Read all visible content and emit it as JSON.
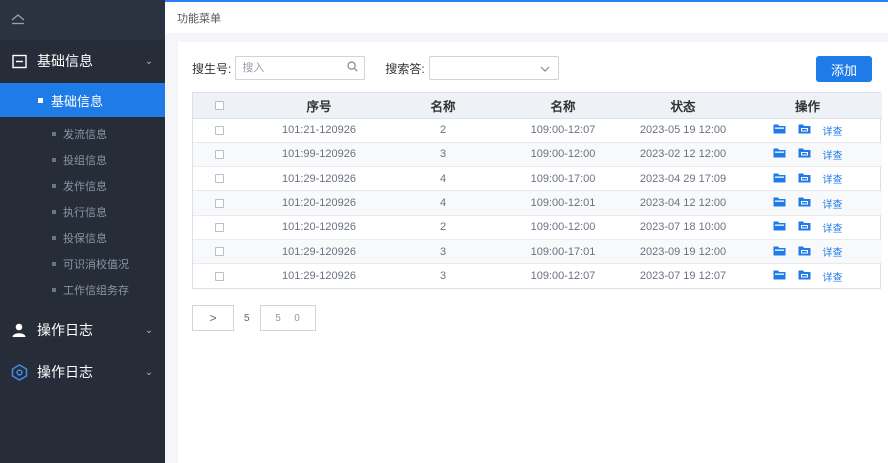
{
  "sidebar": {
    "groups": [
      {
        "label": "基础信息",
        "icon": "info-box-icon"
      },
      {
        "label": "操作日志",
        "icon": "user-icon"
      },
      {
        "label": "操作日志",
        "icon": "hexagon-settings-icon"
      }
    ],
    "active_item": "基础信息",
    "sub_items": [
      "发流信息",
      "投组信息",
      "发作信息",
      "执行信息",
      "投保信息",
      "可识消校值况",
      "工作信组务存"
    ]
  },
  "topbar": {
    "title": "功能菜单"
  },
  "filters": {
    "search_label": "搜生号:",
    "search_placeholder": "搜入",
    "select_label": "搜索答:",
    "select_value": ""
  },
  "add_button": "添加",
  "table": {
    "headers": [
      "",
      "序号",
      "名称",
      "名称",
      "状态",
      "操作"
    ],
    "rows": [
      {
        "id": "101:21-120926",
        "count": "2",
        "time": "109:00-12:07",
        "date": "2023-05 19 12:00",
        "link": "详查"
      },
      {
        "id": "101:99-120926",
        "count": "3",
        "time": "109:00-12:00",
        "date": "2023-02 12 12:00",
        "link": "详查"
      },
      {
        "id": "101:29-120926",
        "count": "4",
        "time": "109:00-17:00",
        "date": "2023-04 29 17:09",
        "link": "详查"
      },
      {
        "id": "101:20-120926",
        "count": "4",
        "time": "109:00-12:01",
        "date": "2023-04 12 12:00",
        "link": "详查"
      },
      {
        "id": "101:20-120926",
        "count": "2",
        "time": "109:00-12:00",
        "date": "2023-07 18 10:00",
        "link": "详查"
      },
      {
        "id": "101:29-120926",
        "count": "3",
        "time": "109:00-17:01",
        "date": "2023-09 19 12:00",
        "link": "详查"
      },
      {
        "id": "101:29-120926",
        "count": "3",
        "time": "109:00-12:07",
        "date": "2023-07 19 12:07",
        "link": "详查"
      }
    ]
  },
  "pager": {
    "next": ">",
    "total": "5",
    "page": "5",
    "size": "0"
  },
  "colors": {
    "accent": "#1f7be8",
    "sidebar_bg": "#262c38"
  }
}
